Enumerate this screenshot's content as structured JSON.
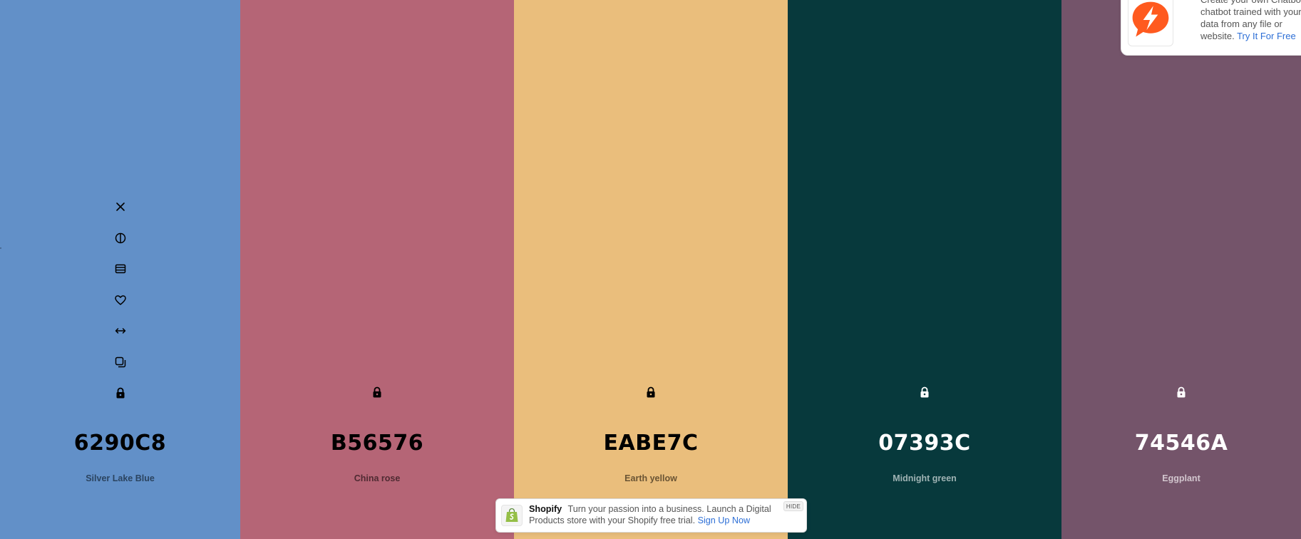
{
  "palette": [
    {
      "hex": "6290C8",
      "name": "Silver Lake Blue",
      "bg": "#6290C8",
      "fg": "#000000",
      "name_color": "#2b4460",
      "locked": true
    },
    {
      "hex": "B56576",
      "name": "China rose",
      "bg": "#B56576",
      "fg": "#000000",
      "name_color": "#4f2a32",
      "locked": true
    },
    {
      "hex": "EABE7C",
      "name": "Earth yellow",
      "bg": "#EABE7C",
      "fg": "#000000",
      "name_color": "#6a5434",
      "locked": true
    },
    {
      "hex": "07393C",
      "name": "Midnight green",
      "bg": "#07393C",
      "fg": "#ffffff",
      "name_color": "#9fb3b4",
      "locked": true
    },
    {
      "hex": "74546A",
      "name": "Eggplant",
      "bg": "#74546A",
      "fg": "#ffffff",
      "name_color": "#d2c6ce",
      "locked": true
    }
  ],
  "tools": [
    "close-icon",
    "contrast-icon",
    "view-shades-icon",
    "heart-icon",
    "drag-icon",
    "copy-icon",
    "lock-icon"
  ],
  "ad": {
    "text": "Create your own Chatbot chatbot trained with your data from any file or website.",
    "link": "Try It For Free",
    "accent": "#ff5a1f"
  },
  "shopify": {
    "brand": "Shopify",
    "text": "Turn your passion into a business. Launch a Digital Products store with your Shopify free trial.",
    "link": "Sign Up Now",
    "hide": "HIDE"
  }
}
